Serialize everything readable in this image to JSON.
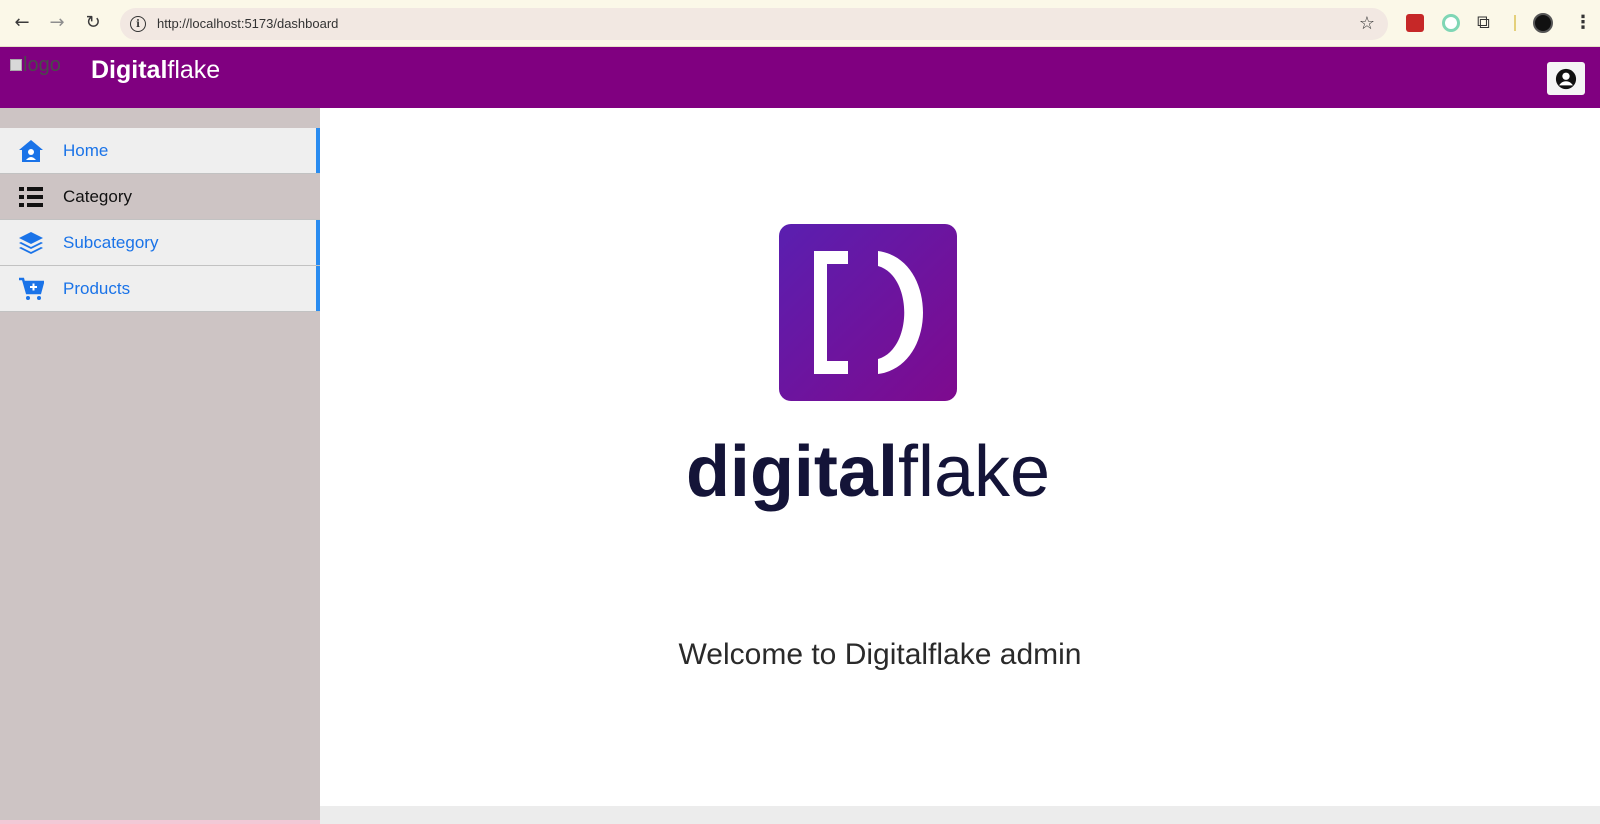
{
  "browser": {
    "url": "http://localhost:5173/dashboard"
  },
  "header": {
    "logo_alt": "logo",
    "brand_bold": "Digital",
    "brand_light": "flake"
  },
  "sidebar": {
    "items": [
      {
        "label": "Home",
        "icon": "home-icon"
      },
      {
        "label": "Category",
        "icon": "list-icon"
      },
      {
        "label": "Subcategory",
        "icon": "layers-icon"
      },
      {
        "label": "Products",
        "icon": "cart-icon"
      }
    ]
  },
  "main": {
    "hero_wordmark_bold": "digital",
    "hero_wordmark_light": "flake",
    "welcome": "Welcome to Digitalflake admin"
  },
  "colors": {
    "header": "#800080",
    "accent_blue": "#1a73e8",
    "sidebar": "#cdc4c4"
  }
}
